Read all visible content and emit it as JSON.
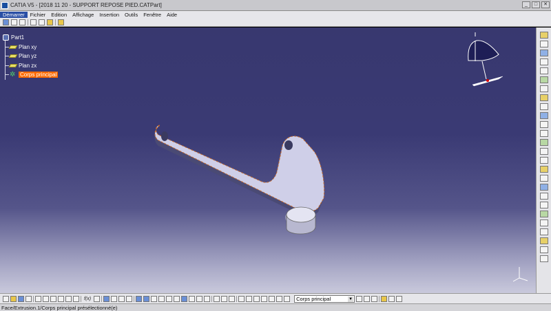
{
  "window": {
    "title": "CATIA V5 - [2018 11 20 - SUPPORT REPOSE PIED.CATPart]"
  },
  "menu": [
    "Démarrer",
    "Fichier",
    "Edition",
    "Affichage",
    "Insertion",
    "Outils",
    "Fenêtre",
    "Aide"
  ],
  "tree": {
    "root": "Part1",
    "items": [
      "Plan xy",
      "Plan yz",
      "Plan zx"
    ],
    "selected": "Corps principal"
  },
  "bottom_toolbar": {
    "formula_label": "f(x)",
    "body_select": "Corps principal"
  },
  "status": {
    "text": "Face/Extrusion.1/Corps principal présélectionné(e)"
  },
  "colors": {
    "selection": "#ff6a00",
    "part_face": "#cfcfe8",
    "part_edge": "#c86a2a",
    "viewport_top": "#38386f",
    "viewport_bottom": "#c9c9dc"
  },
  "icons": {
    "tree_root": "part-icon",
    "planes": "plane-icon",
    "body": "gear-icon",
    "compass": "compass-icon"
  }
}
